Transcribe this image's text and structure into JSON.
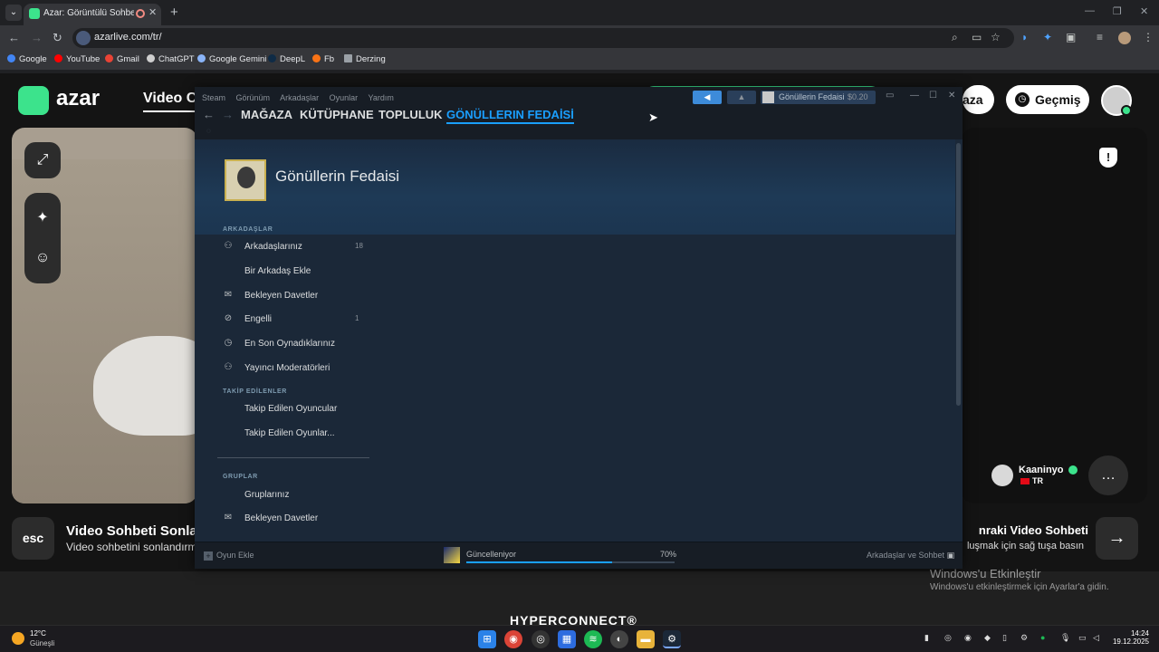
{
  "browser": {
    "tab_title": "Azar: Görüntülü Sohbet & V",
    "url": "azarlive.com/tr/",
    "bookmarks": [
      "Google",
      "YouTube",
      "Gmail",
      "ChatGPT",
      "Google Gemini",
      "DeepL",
      "Fb",
      "Derzing"
    ]
  },
  "azar": {
    "logo": "azar",
    "nav_video": "Video C",
    "history_button": "Geçmiş",
    "store_button_partial": "aza",
    "peer_name": "Kaaninyo",
    "peer_country": "TR",
    "esc_label": "esc",
    "end_title": "Video Sohbeti Sonlar",
    "end_subtitle": "Video sohbetini sonlandırm",
    "next_title": "nraki Video Sohbeti",
    "next_subtitle": "luşmak için sağ tuşa basın",
    "footer_brand": "HYPERCONNECT®",
    "windows_activate_title": "Windows'u Etkinleştir",
    "windows_activate_sub": "Windows'u etkinleştirmek için Ayarlar'a gidin."
  },
  "steam": {
    "menu": [
      "Steam",
      "Görünüm",
      "Arkadaşlar",
      "Oyunlar",
      "Yardım"
    ],
    "tabs": [
      "MAĞAZA",
      "KÜTÜPHANE",
      "TOPLULUK",
      "GÖNÜLLERIN FEDAİSİ"
    ],
    "user_name": "Gönüllerin Fedaisi",
    "wallet": "$0.20",
    "profile_name": "Gönüllerin Fedaisi",
    "sections": {
      "friends_header": "ARKADAŞLAR",
      "following_header": "TAKİP EDİLENLER",
      "groups_header": "GRUPLAR"
    },
    "friends_items": [
      {
        "icon": "person-icon",
        "label": "Arkadaşlarınız",
        "count": "18"
      },
      {
        "icon": "",
        "label": "Bir Arkadaş Ekle",
        "count": ""
      },
      {
        "icon": "envelope-icon",
        "label": "Bekleyen Davetler",
        "count": ""
      },
      {
        "icon": "blocked-icon",
        "label": "Engelli",
        "count": "1"
      },
      {
        "icon": "clock-icon",
        "label": "En Son Oynadıklarınız",
        "count": ""
      },
      {
        "icon": "person-icon",
        "label": "Yayıncı Moderatörleri",
        "count": ""
      }
    ],
    "following_items": [
      {
        "label": "Takip Edilen Oyuncular"
      },
      {
        "label": "Takip Edilen Oyunlar..."
      }
    ],
    "groups_items": [
      {
        "icon": "",
        "label": "Gruplarınız"
      },
      {
        "icon": "envelope-icon",
        "label": "Bekleyen Davetler"
      }
    ],
    "bottom": {
      "add_game": "Oyun Ekle",
      "download_label": "Güncelleniyor",
      "download_percent": "70%",
      "download_progress": 0.7,
      "friends_chat": "Arkadaşlar ve Sohbet"
    }
  },
  "taskbar": {
    "weather_temp": "12°C",
    "weather_desc": "Güneşli",
    "time": "14:24",
    "date": "19.12.2025"
  }
}
